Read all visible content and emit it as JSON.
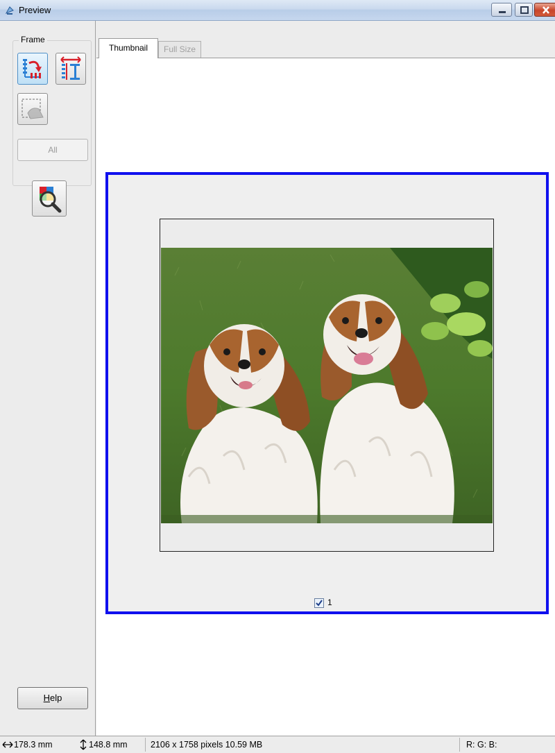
{
  "window": {
    "title": "Preview"
  },
  "left_panel": {
    "frame_group_label": "Frame",
    "all_button_label": "All",
    "help_button_label": "Help",
    "help_button_accel": "H",
    "help_button_rest": "elp"
  },
  "tabs": [
    {
      "label": "Thumbnail",
      "active": true
    },
    {
      "label": "Full Size",
      "active": false
    }
  ],
  "thumbnail": {
    "frame_number": "1",
    "frame_checked": true,
    "selection_color": "#1010ee"
  },
  "statusbar": {
    "width": "178.3 mm",
    "height": "148.8 mm",
    "pixel_info": "2106 x 1758 pixels 10.59 MB",
    "rgb": "R: G: B:"
  },
  "icons": {
    "auto_locate": "auto-locate-icon",
    "marquee": "marquee-icon",
    "remove_marquee": "remove-marquee-icon",
    "zoom_color": "zoom-color-icon",
    "width": "width-arrow-icon",
    "height": "height-arrow-icon"
  }
}
